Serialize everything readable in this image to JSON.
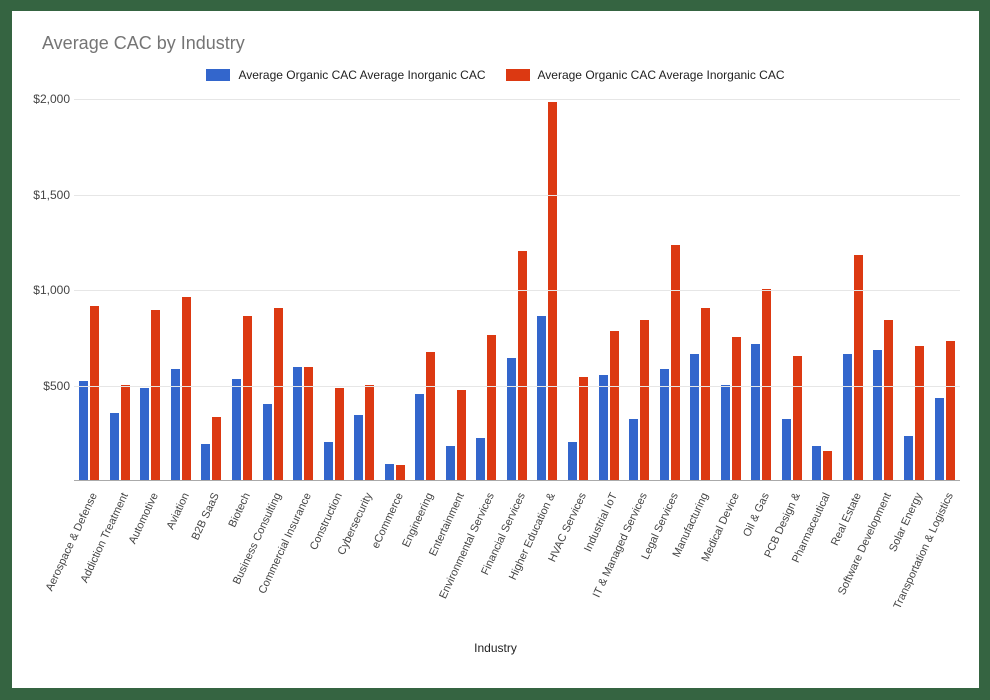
{
  "chart_data": {
    "type": "bar",
    "title": "Average CAC by Industry",
    "xlabel": "Industry",
    "ylabel": "",
    "ylim": [
      0,
      2000
    ],
    "y_prefix": "$",
    "y_step": 500,
    "series": [
      {
        "name": "Average Organic CAC Average Inorganic CAC",
        "color": "#3366cc"
      },
      {
        "name": "Average Organic CAC Average Inorganic CAC",
        "color": "#dc3912"
      }
    ],
    "categories": [
      "Aerospace & Defense",
      "Addiction Treatment",
      "Automotive",
      "Aviation",
      "B2B SaaS",
      "Biotech",
      "Business Consulting",
      "Commercial Insurance",
      "Construction",
      "Cybersecurity",
      "eCommerce",
      "Engineering",
      "Entertainment",
      "Environmental Services",
      "Financial Services",
      "Higher Education &",
      "HVAC Services",
      "Industrial IoT",
      "IT & Managed Services",
      "Legal Services",
      "Manufacturing",
      "Medical Device",
      "Oil & Gas",
      "PCB Design &",
      "Pharmaceutical",
      "Real Estate",
      "Software Development",
      "Solar Energy",
      "Transportation & Logistics"
    ],
    "values_series_0": [
      520,
      350,
      480,
      580,
      190,
      530,
      400,
      590,
      200,
      340,
      85,
      450,
      180,
      220,
      640,
      860,
      200,
      550,
      320,
      580,
      660,
      500,
      710,
      320,
      180,
      660,
      680,
      230,
      430
    ],
    "values_series_1": [
      910,
      500,
      890,
      960,
      330,
      860,
      900,
      590,
      480,
      500,
      80,
      670,
      470,
      760,
      1200,
      1980,
      540,
      780,
      840,
      1230,
      900,
      750,
      1000,
      650,
      150,
      1180,
      840,
      700,
      730
    ]
  }
}
